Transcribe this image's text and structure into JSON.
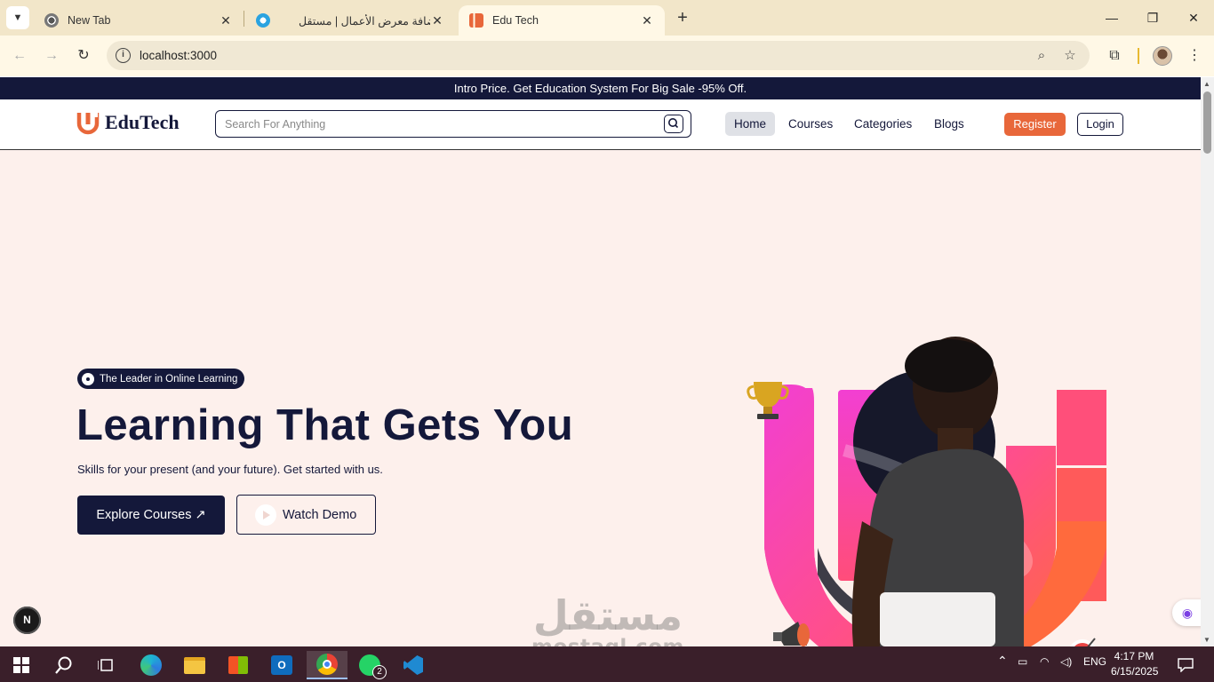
{
  "browser": {
    "tabs": [
      {
        "title": "New Tab"
      },
      {
        "title": "إضافة معرض الأعمال | مستقل"
      },
      {
        "title": "Edu Tech"
      }
    ],
    "url": "localhost:3000",
    "icons": {
      "tab_menu": "chevron-down-icon",
      "new_tab": "+",
      "minimize": "—",
      "restore": "❐",
      "close": "✕",
      "back": "←",
      "forward": "→",
      "reload": "↻",
      "info": "i",
      "zoom": "⌕",
      "star": "☆",
      "extensions": "⧉",
      "menu": "⋮"
    }
  },
  "promo": {
    "text": "Intro Price. Get Education System For Big Sale -95% Off."
  },
  "header": {
    "logo_text": "EduTech",
    "search_placeholder": "Search For Anything",
    "nav": [
      "Home",
      "Courses",
      "Categories",
      "Blogs"
    ],
    "register": "Register",
    "login": "Login"
  },
  "hero": {
    "badge": "The Leader in Online Learning",
    "title": "Learning That Gets You",
    "subtitle": "Skills for your present (and your future). Get started with us.",
    "explore": "Explore Courses ↗",
    "demo": "Watch Demo"
  },
  "widgets": {
    "next": "N"
  },
  "watermark": {
    "arabic": "مستقل",
    "latin": "mostaql.com"
  },
  "taskbar": {
    "tray_lang": "ENG",
    "time": "4:17 PM",
    "date": "6/15/2025",
    "whatsapp_badge": "2"
  },
  "colors": {
    "navy": "#14183a",
    "accent": "#e8673a",
    "hero_bg": "#fdf0ec",
    "pink": "#f23fa7",
    "orange": "#ff6a3d"
  }
}
